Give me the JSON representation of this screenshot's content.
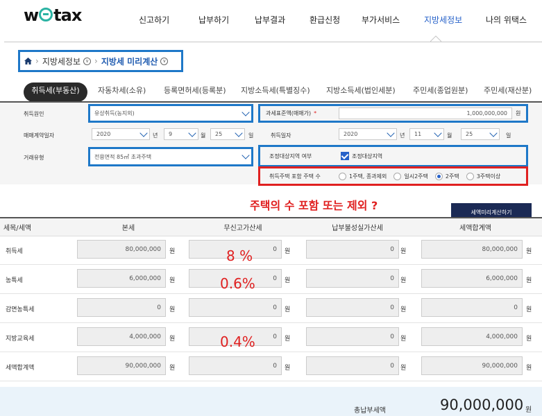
{
  "header": {
    "logo_left": "w",
    "logo_right": "tax",
    "nav": [
      "신고하기",
      "납부하기",
      "납부결과",
      "환급신청",
      "부가서비스",
      "지방세정보",
      "나의 위택스"
    ]
  },
  "breadcrumb": {
    "item1": "지방세정보",
    "item2": "지방세 미리계산"
  },
  "tabs": [
    "취득세(부동산)",
    "자동차세(소유)",
    "등록면허세(등록분)",
    "지방소득세(특별징수)",
    "지방소득세(법인세분)",
    "주민세(종업원분)",
    "주민세(재산분)"
  ],
  "form": {
    "acq_cause_label": "취득원인",
    "acq_cause_value": "유상취득(농지외)",
    "tax_base_label": "과세표준액(매매가)",
    "tax_base_required": "*",
    "tax_base_value": "1,000,000,000",
    "won": "원",
    "contract_date_label": "매매계약일자",
    "contract_year": "2020",
    "contract_month": "9",
    "contract_day": "25",
    "acq_date_label": "취득일자",
    "acq_year": "2020",
    "acq_month": "11",
    "acq_day": "25",
    "unit_year": "년",
    "unit_month": "월",
    "unit_day": "일",
    "trade_type_label": "거래유형",
    "trade_type_value": "전용면적 85㎡ 초과주택",
    "adj_area_label": "조정대상지역 여부",
    "adj_area_value": "조정대상지역",
    "house_count_label": "취득주택 포함 주택 수",
    "house_options": [
      "1주택, 종과제외",
      "일시2주택",
      "2주택",
      "3주택이상"
    ]
  },
  "annotation": "주택의 수 포함 또는 제외 ?",
  "calc_button": "세액미리계산하기",
  "table": {
    "headers": [
      "세목/세액",
      "본세",
      "무신고가산세",
      "납부불성실가산세",
      "세액합계액"
    ],
    "rows": [
      {
        "label": "취득세",
        "main": "80,000,000",
        "nofile": "0",
        "late": "0",
        "total": "80,000,000"
      },
      {
        "label": "농특세",
        "main": "6,000,000",
        "nofile": "0",
        "late": "0",
        "total": "6,000,000"
      },
      {
        "label": "감면농특세",
        "main": "0",
        "nofile": "0",
        "late": "0",
        "total": "0"
      },
      {
        "label": "지방교육세",
        "main": "4,000,000",
        "nofile": "0",
        "late": "0",
        "total": "4,000,000"
      },
      {
        "label": "세액합계액",
        "main": "90,000,000",
        "nofile": "0",
        "late": "0",
        "total": "90,000,000"
      }
    ],
    "unit": "원"
  },
  "rate_notes": [
    "8 %",
    "0.6%",
    "0.4%"
  ],
  "total": {
    "label": "총납부세액",
    "value": "90,000,000",
    "unit": "원"
  },
  "colors": {
    "highlight_blue": "#1e78c8",
    "highlight_red": "#e02020",
    "accent": "#2762c9"
  }
}
